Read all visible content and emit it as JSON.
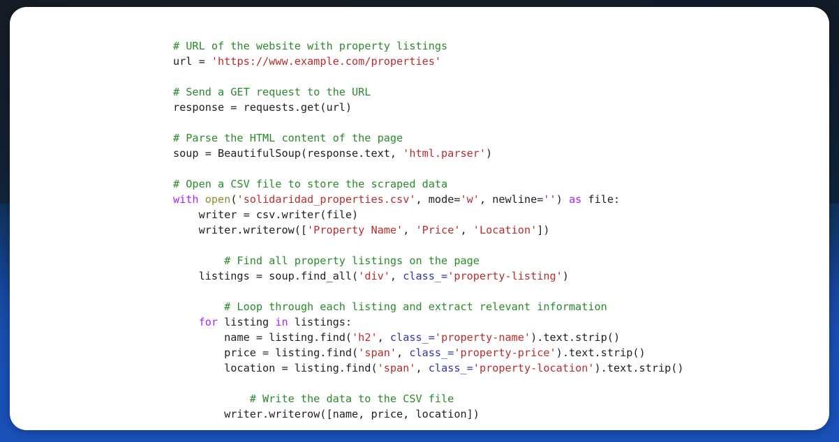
{
  "theme": {
    "card_background": "#ffffff",
    "backdrop_top": "#161d27",
    "backdrop_bottom": "#1a50b8",
    "comment_color": "#2a8a2a",
    "string_color": "#ba2c2c",
    "keyword_color": "#aa22ff",
    "builtin_color": "#8a8a33",
    "attribute_color": "#3333aa",
    "plain_color": "#202020"
  },
  "code": {
    "language": "python",
    "lines": [
      {
        "indent": 0,
        "tokens": [
          {
            "t": "comment",
            "v": "# URL of the website with property listings"
          }
        ]
      },
      {
        "indent": 0,
        "tokens": [
          {
            "t": "plain",
            "v": "url = "
          },
          {
            "t": "string",
            "v": "'https://www.example.com/properties'"
          }
        ]
      },
      {
        "indent": 0,
        "tokens": []
      },
      {
        "indent": 0,
        "tokens": [
          {
            "t": "comment",
            "v": "# Send a GET request to the URL"
          }
        ]
      },
      {
        "indent": 0,
        "tokens": [
          {
            "t": "plain",
            "v": "response = requests.get(url)"
          }
        ]
      },
      {
        "indent": 0,
        "tokens": []
      },
      {
        "indent": 0,
        "tokens": [
          {
            "t": "comment",
            "v": "# Parse the HTML content of the page"
          }
        ]
      },
      {
        "indent": 0,
        "tokens": [
          {
            "t": "plain",
            "v": "soup = BeautifulSoup(response.text, "
          },
          {
            "t": "string",
            "v": "'html.parser'"
          },
          {
            "t": "plain",
            "v": ")"
          }
        ]
      },
      {
        "indent": 0,
        "tokens": []
      },
      {
        "indent": 0,
        "tokens": [
          {
            "t": "comment",
            "v": "# Open a CSV file to store the scraped data"
          }
        ]
      },
      {
        "indent": 0,
        "tokens": [
          {
            "t": "kw",
            "v": "with"
          },
          {
            "t": "plain",
            "v": " "
          },
          {
            "t": "builtin",
            "v": "open"
          },
          {
            "t": "plain",
            "v": "("
          },
          {
            "t": "string",
            "v": "'solidaridad_properties.csv'"
          },
          {
            "t": "plain",
            "v": ", mode="
          },
          {
            "t": "string",
            "v": "'w'"
          },
          {
            "t": "plain",
            "v": ", newline="
          },
          {
            "t": "string",
            "v": "''"
          },
          {
            "t": "plain",
            "v": ") "
          },
          {
            "t": "kw",
            "v": "as"
          },
          {
            "t": "plain",
            "v": " file:"
          }
        ]
      },
      {
        "indent": 4,
        "tokens": [
          {
            "t": "plain",
            "v": "writer = csv.writer(file)"
          }
        ]
      },
      {
        "indent": 4,
        "tokens": [
          {
            "t": "plain",
            "v": "writer.writerow(["
          },
          {
            "t": "string",
            "v": "'Property Name'"
          },
          {
            "t": "plain",
            "v": ", "
          },
          {
            "t": "string",
            "v": "'Price'"
          },
          {
            "t": "plain",
            "v": ", "
          },
          {
            "t": "string",
            "v": "'Location'"
          },
          {
            "t": "plain",
            "v": "])"
          }
        ]
      },
      {
        "indent": 0,
        "tokens": []
      },
      {
        "indent": 8,
        "tokens": [
          {
            "t": "comment",
            "v": "# Find all property listings on the page"
          }
        ]
      },
      {
        "indent": 4,
        "tokens": [
          {
            "t": "plain",
            "v": "listings = soup.find_all("
          },
          {
            "t": "string",
            "v": "'div'"
          },
          {
            "t": "plain",
            "v": ", "
          },
          {
            "t": "attr",
            "v": "class_="
          },
          {
            "t": "string",
            "v": "'property-listing'"
          },
          {
            "t": "plain",
            "v": ")"
          }
        ]
      },
      {
        "indent": 0,
        "tokens": []
      },
      {
        "indent": 8,
        "tokens": [
          {
            "t": "comment",
            "v": "# Loop through each listing and extract relevant information"
          }
        ]
      },
      {
        "indent": 4,
        "tokens": [
          {
            "t": "kw",
            "v": "for"
          },
          {
            "t": "plain",
            "v": " listing "
          },
          {
            "t": "kw",
            "v": "in"
          },
          {
            "t": "plain",
            "v": " listings:"
          }
        ]
      },
      {
        "indent": 8,
        "tokens": [
          {
            "t": "plain",
            "v": "name = listing.find("
          },
          {
            "t": "string",
            "v": "'h2'"
          },
          {
            "t": "plain",
            "v": ", "
          },
          {
            "t": "attr",
            "v": "class_="
          },
          {
            "t": "string",
            "v": "'property-name'"
          },
          {
            "t": "plain",
            "v": ").text.strip()"
          }
        ]
      },
      {
        "indent": 8,
        "tokens": [
          {
            "t": "plain",
            "v": "price = listing.find("
          },
          {
            "t": "string",
            "v": "'span'"
          },
          {
            "t": "plain",
            "v": ", "
          },
          {
            "t": "attr",
            "v": "class_="
          },
          {
            "t": "string",
            "v": "'property-price'"
          },
          {
            "t": "plain",
            "v": ").text.strip()"
          }
        ]
      },
      {
        "indent": 8,
        "tokens": [
          {
            "t": "plain",
            "v": "location = listing.find("
          },
          {
            "t": "string",
            "v": "'span'"
          },
          {
            "t": "plain",
            "v": ", "
          },
          {
            "t": "attr",
            "v": "class_="
          },
          {
            "t": "string",
            "v": "'property-location'"
          },
          {
            "t": "plain",
            "v": ").text.strip()"
          }
        ]
      },
      {
        "indent": 0,
        "tokens": []
      },
      {
        "indent": 12,
        "tokens": [
          {
            "t": "comment",
            "v": "# Write the data to the CSV file"
          }
        ]
      },
      {
        "indent": 8,
        "tokens": [
          {
            "t": "plain",
            "v": "writer.writerow([name, price, location])"
          }
        ]
      }
    ]
  }
}
